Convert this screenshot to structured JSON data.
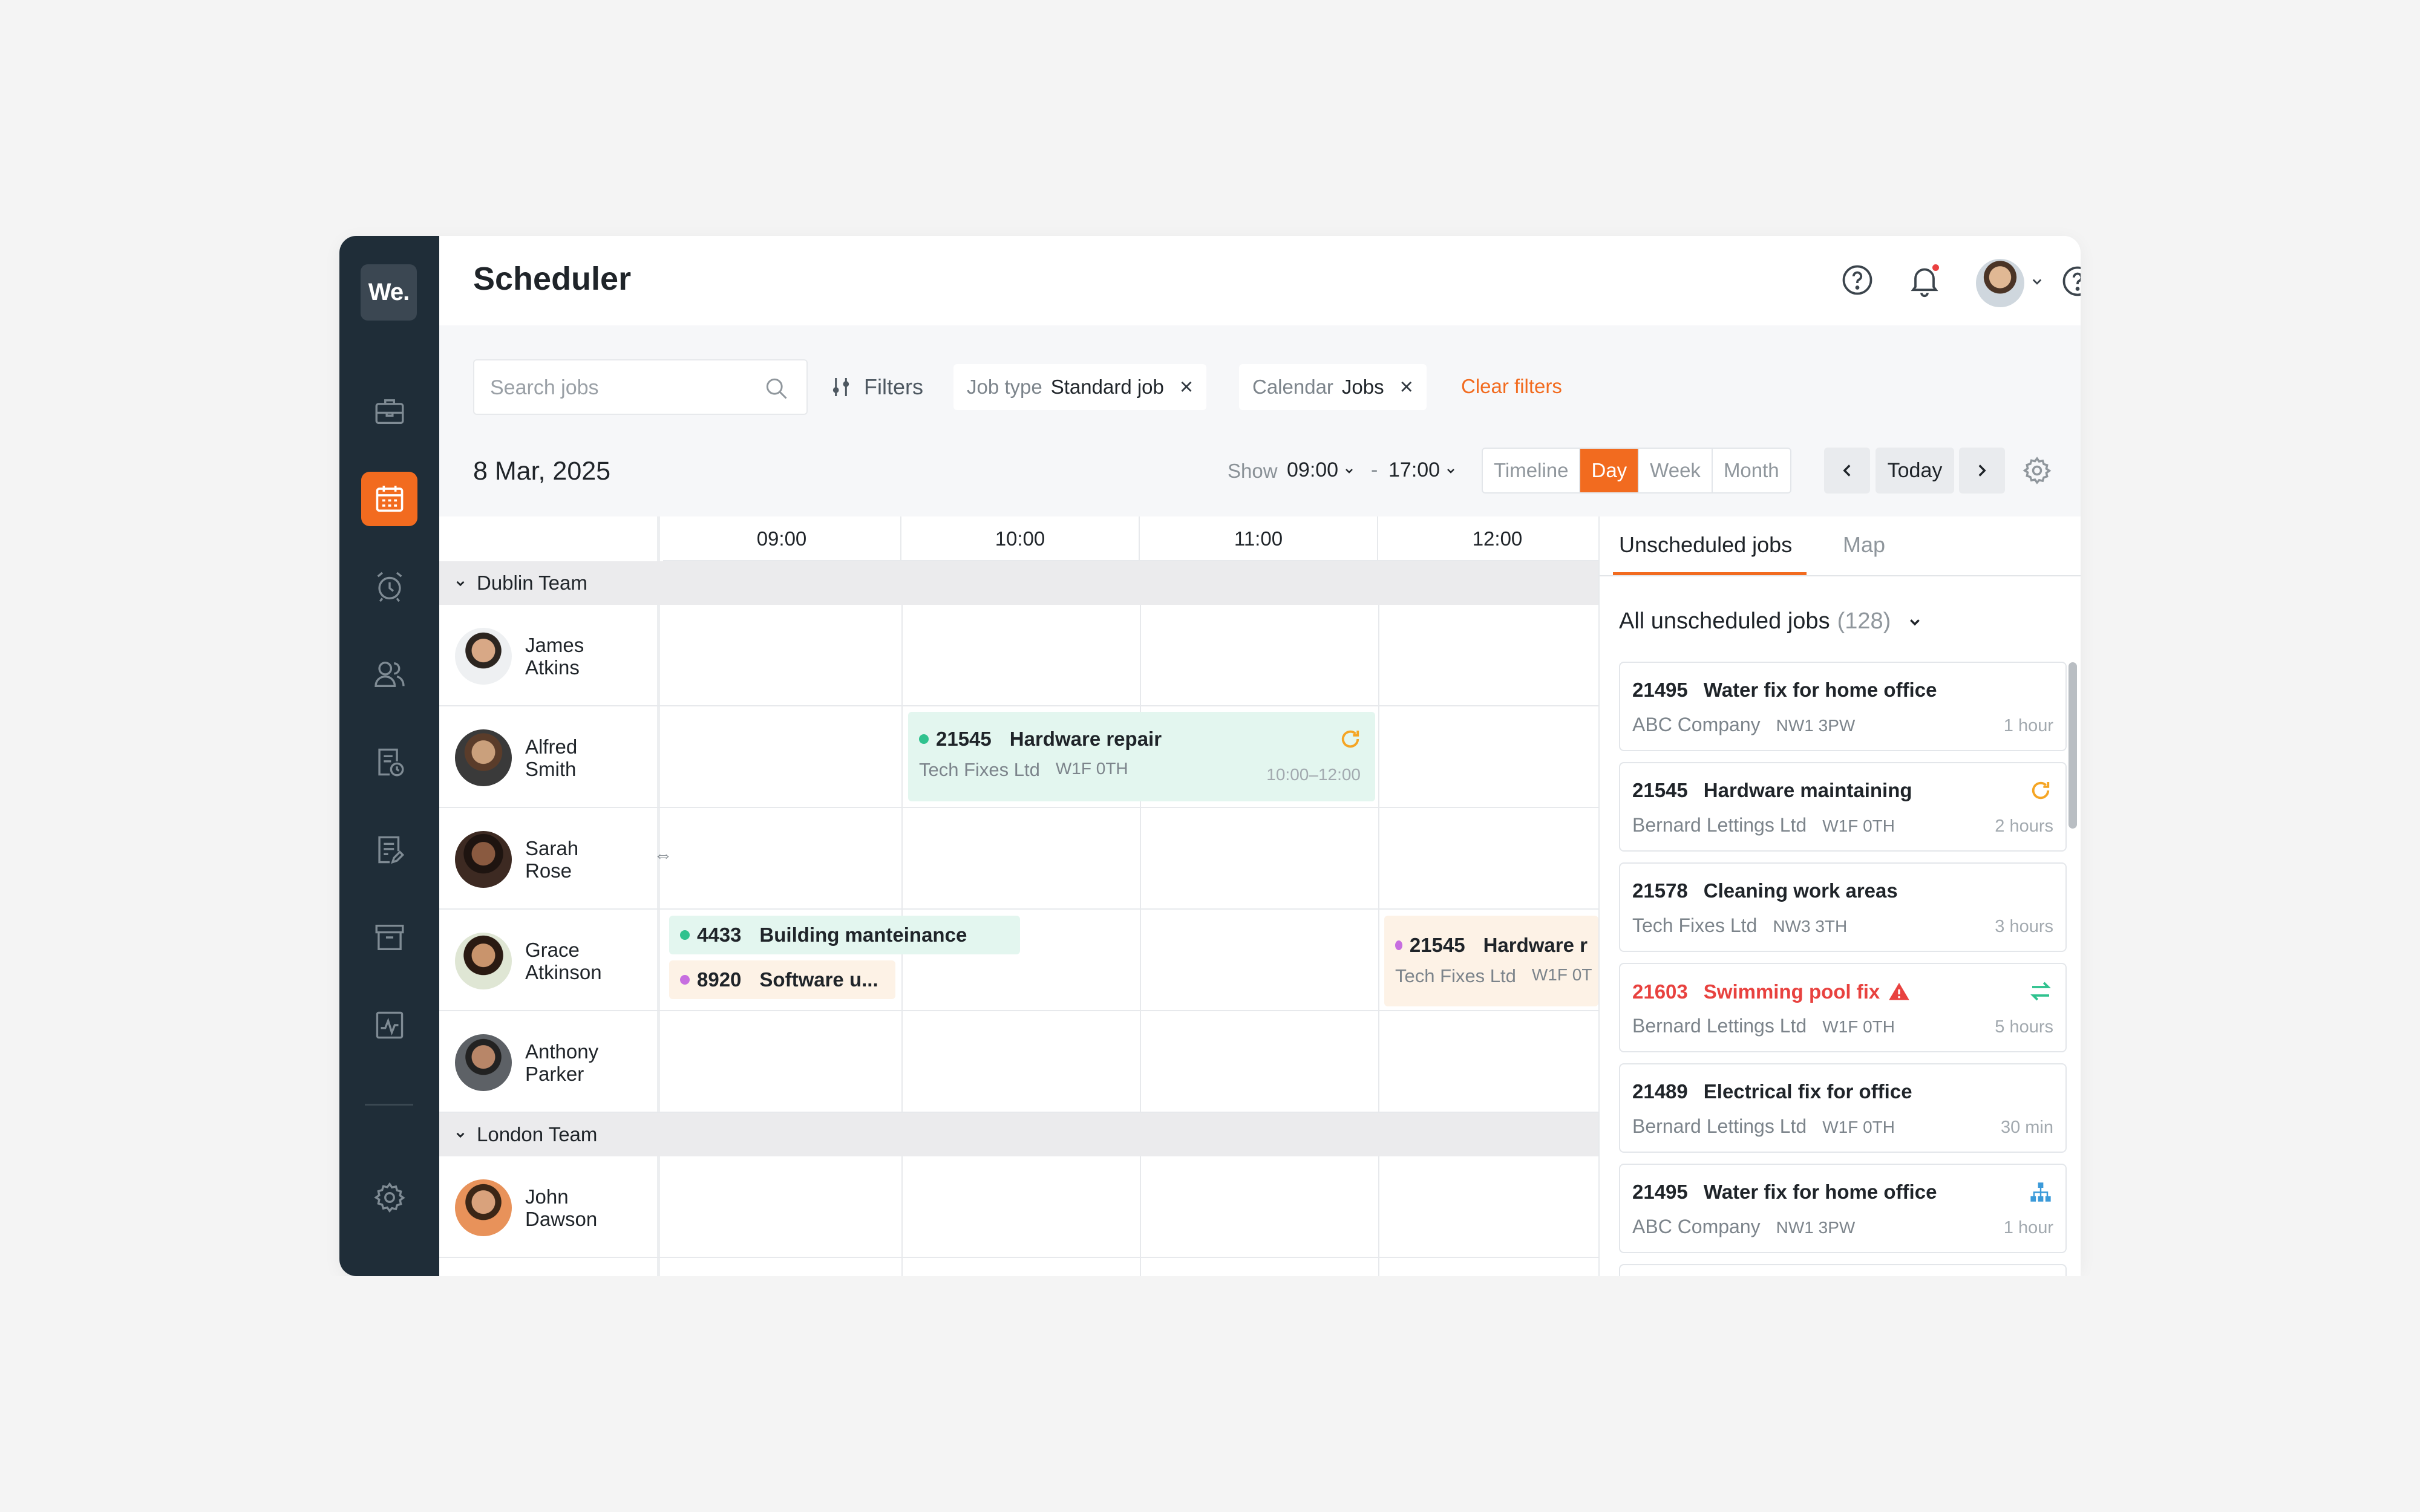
{
  "app": {
    "logo_text": "We.",
    "title": "Scheduler"
  },
  "sidebar": {
    "items": [
      {
        "name": "jobs",
        "icon": "briefcase-icon"
      },
      {
        "name": "scheduler",
        "icon": "calendar-icon",
        "active": true
      },
      {
        "name": "reminders",
        "icon": "alarm-clock-icon"
      },
      {
        "name": "users",
        "icon": "users-icon"
      },
      {
        "name": "reports",
        "icon": "document-clock-icon"
      },
      {
        "name": "documents",
        "icon": "document-edit-icon"
      },
      {
        "name": "archive",
        "icon": "archive-icon"
      },
      {
        "name": "analytics",
        "icon": "activity-chart-icon"
      }
    ],
    "settings_icon": "gear-icon"
  },
  "header": {
    "icons": [
      "search-icon",
      "help-icon",
      "bell-icon"
    ],
    "notification": true
  },
  "toolbar": {
    "search_placeholder": "Search jobs",
    "filters_label": "Filters",
    "chips": [
      {
        "key": "Job type",
        "value": "Standard job"
      },
      {
        "key": "Calendar",
        "value": "Jobs"
      }
    ],
    "clear_label": "Clear filters",
    "date": "8 Mar, 2025",
    "show_label": "Show",
    "start_time": "09:00",
    "dash": "-",
    "end_time": "17:00",
    "views": [
      "Timeline",
      "Day",
      "Week",
      "Month"
    ],
    "active_view": "Day",
    "today_label": "Today"
  },
  "schedule": {
    "times": [
      "09:00",
      "10:00",
      "11:00",
      "12:00"
    ],
    "teams": [
      {
        "name": "Dublin Team",
        "members": [
          "James Atkins",
          "Alfred Smith",
          "Sarah Rose",
          "Grace Atkinson",
          "Anthony Parker"
        ]
      },
      {
        "name": "London Team",
        "members": [
          "John Dawson"
        ]
      }
    ],
    "people": [
      {
        "first": "James",
        "last": "Atkins"
      },
      {
        "first": "Alfred",
        "last": "Smith"
      },
      {
        "first": "Sarah",
        "last": "Rose"
      },
      {
        "first": "Grace",
        "last": "Atkinson"
      },
      {
        "first": "Anthony",
        "last": "Parker"
      },
      {
        "first": "John",
        "last": "Dawson"
      }
    ],
    "events": [
      {
        "id": "21545",
        "title": "Hardware  repair",
        "company": "Tech Fixes Ltd",
        "postcode": "W1F 0TH",
        "time": "10:00–12:00",
        "color": "#e3f6ef",
        "dot": "#2fc28e",
        "icon": "refresh-icon"
      },
      {
        "id": "4433",
        "title": "Building manteinance",
        "color": "#e3f6ef",
        "dot": "#2fc28e"
      },
      {
        "id": "8920",
        "title": "Software u...",
        "color": "#fdf2e6",
        "dot": "#c76ee0"
      },
      {
        "id": "21545",
        "title": "Hardware  r",
        "company": "Tech Fixes Ltd",
        "postcode": "W1F 0T",
        "color": "#fdf2e6",
        "dot": "#c76ee0"
      }
    ]
  },
  "panel": {
    "tabs": [
      "Unscheduled jobs",
      "Map"
    ],
    "all_label": "All unscheduled jobs",
    "count": "(128)",
    "jobs": [
      {
        "id": "21495",
        "title": "Water fix for home office",
        "company": "ABC Company",
        "postcode": "NW1 3PW",
        "duration": "1 hour"
      },
      {
        "id": "21545",
        "title": "Hardware maintaining",
        "company": "Bernard Lettings Ltd",
        "postcode": "W1F 0TH",
        "duration": "2 hours",
        "icon": "refresh-icon"
      },
      {
        "id": "21578",
        "title": "Cleaning work areas",
        "company": "Tech Fixes Ltd",
        "postcode": "NW3 3TH",
        "duration": "3 hours"
      },
      {
        "id": "21603",
        "title": "Swimming pool fix",
        "company": "Bernard Lettings Ltd",
        "postcode": "W1F 0TH",
        "duration": "5 hours",
        "alert": true,
        "icon": "swap-icon"
      },
      {
        "id": "21489",
        "title": "Electrical fix for office",
        "company": "Bernard Lettings Ltd",
        "postcode": "W1F 0TH",
        "duration": "30 min"
      },
      {
        "id": "21495",
        "title": "Water fix for home office",
        "company": "ABC Company",
        "postcode": "NW1 3PW",
        "duration": "1 hour",
        "icon": "hierarchy-icon"
      }
    ]
  },
  "colors": {
    "accent": "#f26b1f",
    "sidebar": "#1f2d38",
    "alert": "#e8423f",
    "green": "#2fc28e",
    "purple": "#c76ee0"
  }
}
